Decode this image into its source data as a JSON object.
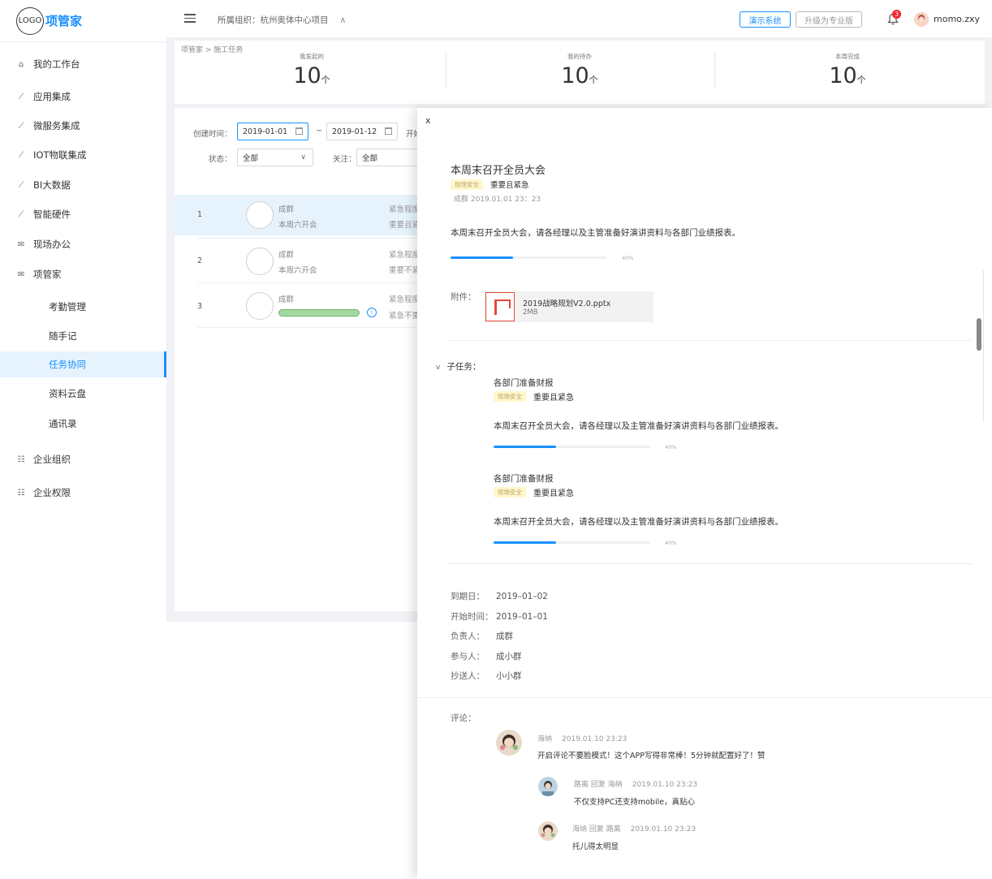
{
  "logo": {
    "mark": "LOGO",
    "name": "项管家"
  },
  "sidebar": {
    "items": [
      {
        "label": "我的工作台",
        "icon": "home-icon"
      },
      {
        "label": "应用集成",
        "icon": "line-chart-icon"
      },
      {
        "label": "微服务集成",
        "icon": "line-chart-icon"
      },
      {
        "label": "IOT物联集成",
        "icon": "line-chart-icon"
      },
      {
        "label": "BI大数据",
        "icon": "line-chart-icon"
      },
      {
        "label": "智能硬件",
        "icon": "line-chart-icon"
      },
      {
        "label": "现场办公",
        "icon": "mail-icon"
      },
      {
        "label": "项管家",
        "icon": "mail-icon"
      }
    ],
    "sub_items": [
      {
        "label": "考勤管理"
      },
      {
        "label": "随手记"
      },
      {
        "label": "任务协同",
        "active": true
      },
      {
        "label": "资料云盘"
      },
      {
        "label": "通讯录"
      }
    ],
    "bottom_items": [
      {
        "label": "企业组织",
        "icon": "form-icon"
      },
      {
        "label": "企业权限",
        "icon": "form-icon"
      }
    ]
  },
  "header": {
    "org_label": "所属组织：杭州奥体中心项目",
    "org_caret": "∧",
    "demo_button": "演示系统",
    "upgrade_button": "升级为专业版",
    "notification_count": "3",
    "username": "momo.zxy"
  },
  "breadcrumb": "项管家 > 施工任务",
  "stats": [
    {
      "label": "我发起的",
      "value": "10",
      "unit": "个"
    },
    {
      "label": "我的待办",
      "value": "10",
      "unit": "个"
    },
    {
      "label": "本周完成",
      "value": "10",
      "unit": "个"
    }
  ],
  "filters": {
    "created_label": "创建时间：",
    "date_start": "2019-01-01",
    "date_sep": "~",
    "date_end": "2019-01-12",
    "start_label": "开始",
    "status_label": "状态：",
    "status_value": "全部",
    "follow_label": "关注：",
    "follow_value": "全部"
  },
  "task_rows": [
    {
      "index": "1",
      "name": "成群",
      "subtitle": "本周六开会",
      "urgency_1": "紧急程度",
      "urgency_2": "重要且紧急"
    },
    {
      "index": "2",
      "name": "成群",
      "subtitle": "本周六开会",
      "urgency_1": "紧急程度",
      "urgency_2": "重要不紧急"
    },
    {
      "index": "3",
      "name": "成群",
      "subtitle": "",
      "urgency_1": "紧急程度",
      "urgency_2": "紧急不重要"
    }
  ],
  "drawer": {
    "close": "x",
    "title": "本周末召开全员大会",
    "tag": "现场安全",
    "importance": "重要且紧急",
    "meta": "成群 2019.01.01 23：23",
    "description": "本周末召开全员大会，请各经理以及主管准备好演讲资料与各部门业绩报表。",
    "progress": 0.4,
    "progress_text": "40%",
    "attachment_label": "附件：",
    "attachment": {
      "name": "2019战略规划V2.0.pptx",
      "size": "2MB",
      "icon": "ppt-file-icon"
    },
    "subtasks_label": "子任务：",
    "subtasks": [
      {
        "title": "各部门准备财报",
        "tag": "现场安全",
        "importance": "重要且紧急",
        "description": "本周末召开全员大会，请各经理以及主管准备好演讲资料与各部门业绩报表。",
        "progress": 0.4,
        "progress_text": "40%"
      },
      {
        "title": "各部门准备财报",
        "tag": "现场安全",
        "importance": "重要且紧急",
        "description": "本周末召开全员大会，请各经理以及主管准备好演讲资料与各部门业绩报表。",
        "progress": 0.4,
        "progress_text": "40%"
      }
    ],
    "info": [
      {
        "key": "到期日：",
        "value": "2019–01–02"
      },
      {
        "key": "开始时间：",
        "value": "2019–01–01"
      },
      {
        "key": "负责人：",
        "value": "成群"
      },
      {
        "key": "参与人：",
        "value": "成小群"
      },
      {
        "key": "抄送人：",
        "value": "小小群"
      }
    ],
    "comments_label": "评论：",
    "comments": [
      {
        "author": "海纳",
        "time": "2019.01.10 23:23",
        "text": "开启评论不要脸模式！这个APP写得非常棒！5分钟就配置好了！赞"
      },
      {
        "author": "路离 回复 海纳",
        "time": "2019.01.10 23:23",
        "text": "不仅支持PC还支持mobile，真贴心"
      },
      {
        "author": "海纳 回复 路离",
        "time": "2019.01.10 23:23",
        "text": "托儿得太明显"
      }
    ]
  },
  "colors": {
    "primary": "#1890ff",
    "sidebar_active_bg": "#e6f3fd",
    "tag_bg": "#fff7cc",
    "badge": "#f5222d"
  }
}
